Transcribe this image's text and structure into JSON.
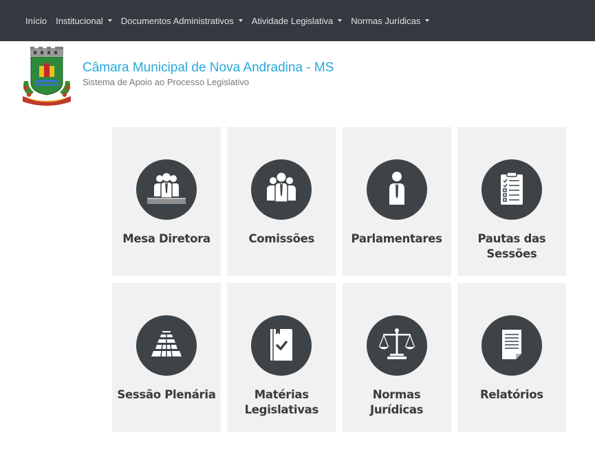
{
  "nav": {
    "items": [
      {
        "label": "Início",
        "dropdown": false
      },
      {
        "label": "Institucional",
        "dropdown": true
      },
      {
        "label": "Documentos Administrativos",
        "dropdown": true
      },
      {
        "label": "Atividade Legislativa",
        "dropdown": true
      },
      {
        "label": "Normas Jurídicas",
        "dropdown": true
      }
    ]
  },
  "header": {
    "title": "Câmara Municipal de Nova Andradina - MS",
    "subtitle": "Sistema de Apoio ao Processo Legislativo"
  },
  "tiles": [
    {
      "label": "Mesa Diretora",
      "icon": "mesa-diretora-icon"
    },
    {
      "label": "Comissões",
      "icon": "comissoes-icon"
    },
    {
      "label": "Parlamentares",
      "icon": "parlamentares-icon"
    },
    {
      "label": "Pautas das Sessões",
      "icon": "pautas-icon"
    },
    {
      "label": "Sessão Plenária",
      "icon": "sessao-plenaria-icon"
    },
    {
      "label": "Matérias Legislativas",
      "icon": "materias-icon"
    },
    {
      "label": "Normas Jurídicas",
      "icon": "normas-icon"
    },
    {
      "label": "Relatórios",
      "icon": "relatorios-icon"
    }
  ],
  "colors": {
    "navbar": "#343a40",
    "title": "#27a8db",
    "tile_bg": "#f1f1f1",
    "icon_circle": "#3d4346"
  }
}
